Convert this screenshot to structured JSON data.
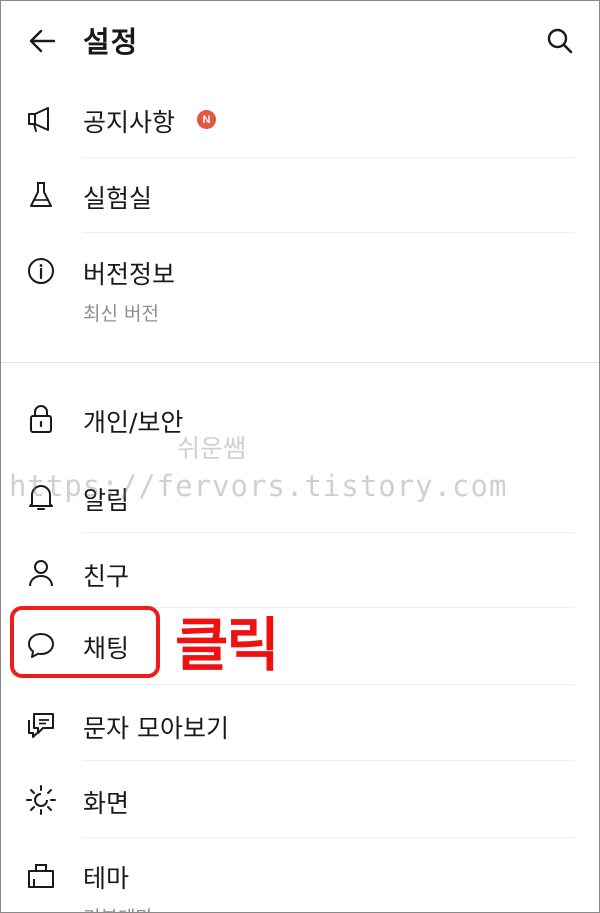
{
  "header": {
    "title": "설정",
    "back_icon": "arrow-left-icon",
    "search_icon": "search-icon"
  },
  "items": [
    {
      "id": "notice",
      "label": "공지사항",
      "icon": "megaphone-icon",
      "badge": "N"
    },
    {
      "id": "lab",
      "label": "실험실",
      "icon": "flask-icon"
    },
    {
      "id": "version",
      "label": "버전정보",
      "icon": "info-icon",
      "sub": "최신 버전"
    },
    {
      "id": "privacy",
      "label": "개인/보안",
      "icon": "lock-icon"
    },
    {
      "id": "alarm",
      "label": "알림",
      "icon": "bell-icon"
    },
    {
      "id": "friends",
      "label": "친구",
      "icon": "person-icon"
    },
    {
      "id": "chat",
      "label": "채팅",
      "icon": "chat-bubble-icon"
    },
    {
      "id": "sms",
      "label": "문자 모아보기",
      "icon": "message-icon"
    },
    {
      "id": "display",
      "label": "화면",
      "icon": "brightness-icon"
    },
    {
      "id": "theme",
      "label": "테마",
      "icon": "theme-icon",
      "sub": "기본테마"
    }
  ],
  "annotation": {
    "text": "클릭",
    "color": "#ef1010"
  },
  "watermark": {
    "name": "쉬운쌤",
    "url": "https://fervors.tistory.com"
  },
  "colors": {
    "badge": "#e0583e",
    "highlight": "#ef1c1c"
  }
}
